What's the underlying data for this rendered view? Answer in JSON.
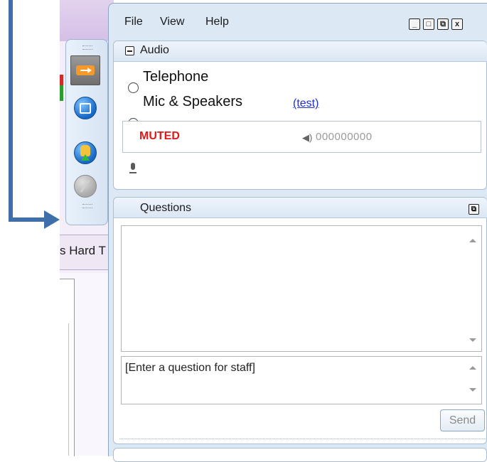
{
  "menu": {
    "file": "File",
    "view": "View",
    "help": "Help"
  },
  "window_buttons": {
    "minimize": "_",
    "maximize": "□",
    "restore": "⧉",
    "close": "x"
  },
  "background_app": {
    "tab_text": "s Hard T"
  },
  "toolbar": {
    "buttons": [
      {
        "icon": "arrow-right-icon",
        "state": "active"
      },
      {
        "icon": "square-circle-icon",
        "state": "normal"
      },
      {
        "icon": "raise-hand-icon",
        "state": "normal"
      },
      {
        "icon": "disabled-circle-icon",
        "state": "disabled"
      }
    ]
  },
  "audio": {
    "title": "Audio",
    "options": [
      {
        "label": "Telephone",
        "selected": false
      },
      {
        "label": "Mic & Speakers",
        "selected": true
      }
    ],
    "test_link": "(test)",
    "mic_status": "MUTED",
    "speaker_level": "000000000"
  },
  "questions": {
    "title": "Questions",
    "input_placeholder": "[Enter a question for staff]",
    "send_label": "Send"
  },
  "colors": {
    "accent": "#3f6fa8",
    "muted": "#e01818",
    "link": "#1f2fd0",
    "panel_bg": "#dde8f5"
  }
}
